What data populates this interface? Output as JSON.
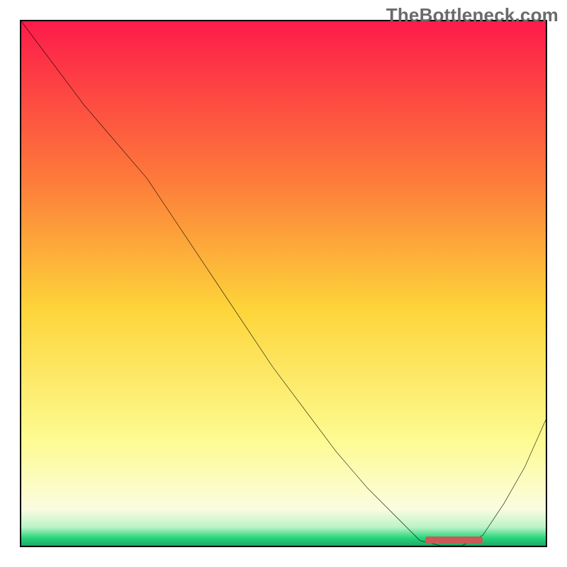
{
  "watermark": "TheBottleneck.com",
  "colors": {
    "gradient_top": "#fd1b4a",
    "gradient_mid_upper": "#fd924a",
    "gradient_mid": "#fde84a",
    "gradient_lower": "#fcfcb0",
    "gradient_green": "#27d67a",
    "curve_stroke": "#000000",
    "valley_marker": "#c95a56",
    "frame_border": "#000000"
  },
  "chart_data": {
    "type": "line",
    "title": "",
    "xlabel": "",
    "ylabel": "",
    "xlim": [
      0,
      100
    ],
    "ylim": [
      0,
      100
    ],
    "series": [
      {
        "name": "bottleneck-curve",
        "x": [
          0,
          6,
          12,
          18,
          24,
          30,
          36,
          42,
          48,
          54,
          60,
          66,
          72,
          76,
          80,
          84,
          88,
          92,
          96,
          100
        ],
        "y": [
          100,
          92,
          84,
          77,
          70,
          61,
          52,
          43,
          34,
          26,
          18,
          11,
          5,
          1,
          0,
          0,
          2,
          8,
          15,
          24
        ]
      }
    ],
    "valley_marker": {
      "x_start": 77,
      "x_end": 88,
      "y": 0.6
    },
    "background_gradient_stops": [
      {
        "offset": 0.0,
        "color": "#fd1b4a"
      },
      {
        "offset": 0.3,
        "color": "#fd7a3a"
      },
      {
        "offset": 0.55,
        "color": "#fdd53a"
      },
      {
        "offset": 0.8,
        "color": "#fdfb92"
      },
      {
        "offset": 0.93,
        "color": "#fbfce0"
      },
      {
        "offset": 0.965,
        "color": "#b9f3c7"
      },
      {
        "offset": 0.985,
        "color": "#27d67a"
      },
      {
        "offset": 1.0,
        "color": "#1fa765"
      }
    ]
  }
}
